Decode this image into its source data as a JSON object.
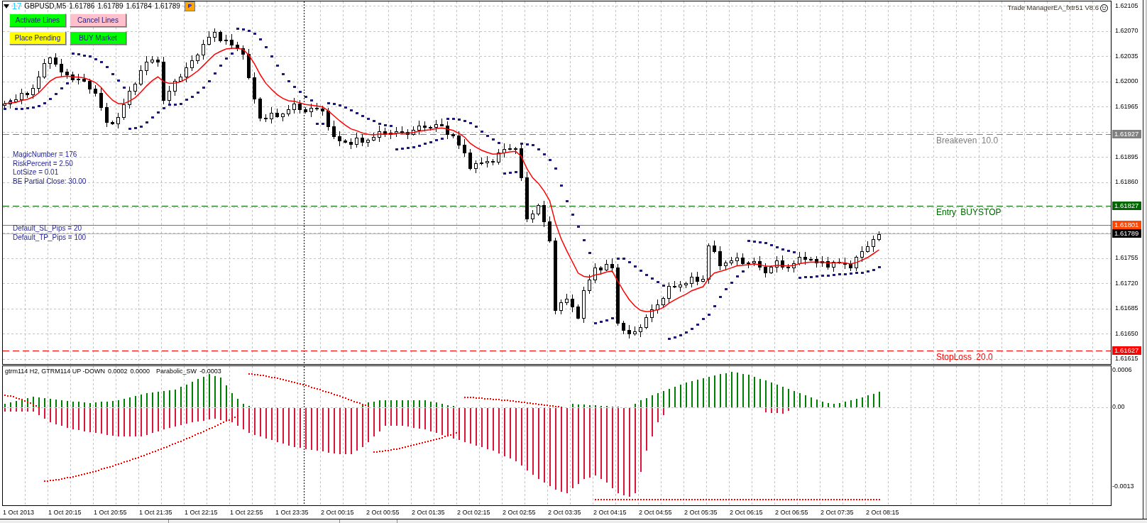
{
  "chart_header": {
    "magic_tag": "17",
    "symbol": "GBPUSD,M5",
    "quotes": [
      "1.61786",
      "1.61789",
      "1.61784",
      "1.61789"
    ],
    "corner_button": "P"
  },
  "expert_label": "Trade ManagerEA_fxtr51 V8.6",
  "buttons": [
    {
      "label": "Activate Lines",
      "color": "#00ff00"
    },
    {
      "label": "Cancel Lines",
      "color": "#ffc0cb"
    },
    {
      "label": "Place Pending",
      "color": "#ffff00"
    },
    {
      "label": "BUY Market",
      "color": "#00ff00"
    }
  ],
  "settings_text": [
    "MagicNumber = 176",
    "RiskPercent = 2.50",
    "LotSize = 0.01",
    "BE Partial Close: 30.00"
  ],
  "default_text": [
    "Default_SL_Pips = 20",
    "Default_TP_Pips = 100"
  ],
  "price_levels": [
    {
      "kind": "breakeven",
      "label": "Breakeven 10.0",
      "price": "1.61927",
      "color": "#808080"
    },
    {
      "kind": "entry",
      "label": "Entry BUYSTOP",
      "price": "1.61827",
      "color": "#006400"
    },
    {
      "kind": "ask",
      "price": "1.61801",
      "color": "#ff4500"
    },
    {
      "kind": "bid",
      "price": "1.61789",
      "color": "#000000"
    },
    {
      "kind": "stoploss",
      "label": "StopLoss 20.0",
      "price": "1.61627",
      "color": "#ff0000"
    }
  ],
  "price_axis": [
    "1.62105",
    "1.62070",
    "1.62035",
    "1.62000",
    "1.61965",
    "1.61895",
    "1.61860",
    "1.61755",
    "1.61720",
    "1.61685",
    "1.61650",
    "1.61615"
  ],
  "indicator": {
    "legend": [
      {
        "name": "gtrm114 H2, GTRM114 UP -DOWN",
        "values": [
          "0.0002",
          "0.0000"
        ]
      },
      {
        "name": "Parabolic_SW",
        "values": [
          "-0.0003"
        ]
      }
    ],
    "axis": [
      "0.0006",
      "0.00",
      "-0.0013"
    ]
  },
  "time_axis": [
    "1 Oct 2013",
    "1 Oct 20:15",
    "1 Oct 20:55",
    "1 Oct 21:35",
    "1 Oct 22:15",
    "1 Oct 22:55",
    "1 Oct 23:35",
    "2 Oct 00:15",
    "2 Oct 00:55",
    "2 Oct 01:35",
    "2 Oct 02:15",
    "2 Oct 02:55",
    "2 Oct 03:35",
    "2 Oct 04:15",
    "2 Oct 04:55",
    "2 Oct 05:35",
    "2 Oct 06:15",
    "2 Oct 06:55",
    "2 Oct 07:35",
    "2 Oct 08:15"
  ]
}
